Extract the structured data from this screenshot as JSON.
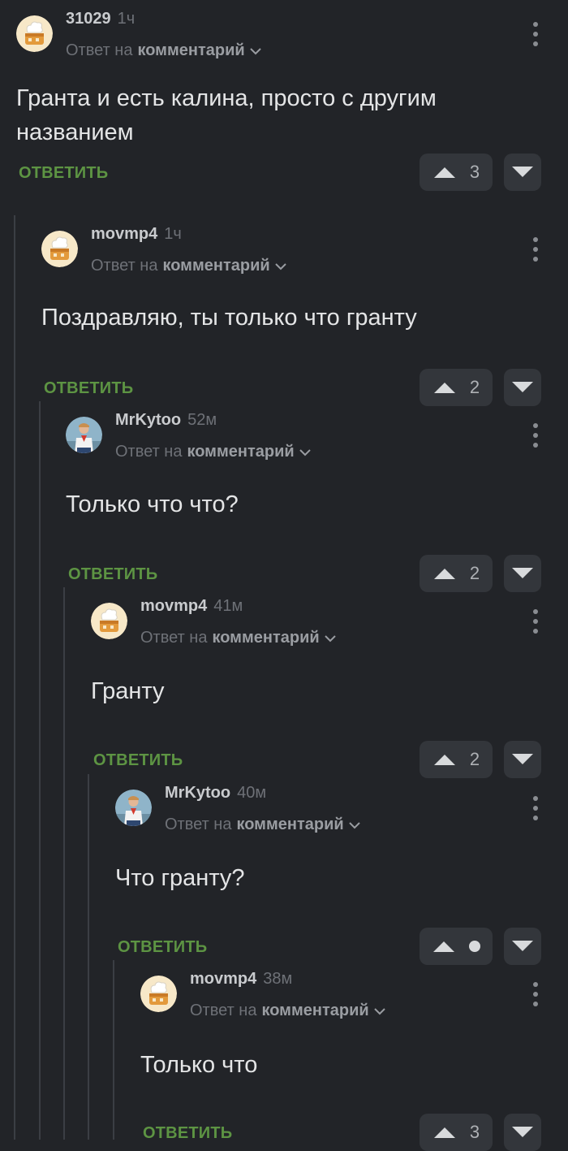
{
  "ui": {
    "reply_prefix": "Ответ на",
    "reply_target": "комментарий",
    "reply_button": "ОТВЕТИТЬ"
  },
  "comments": [
    {
      "author": "31029",
      "time": "1ч",
      "text": "Гранта и есть калина, просто с другим названием",
      "rating": "3",
      "avatar": "chef-hat-avatar"
    },
    {
      "author": "movmp4",
      "time": "1ч",
      "text": "Поздравляю, ты только что гранту",
      "rating": "2",
      "avatar": "chef-hat-avatar"
    },
    {
      "author": "MrKytoo",
      "time": "52м",
      "text": "Только что что?",
      "rating": "2",
      "avatar": "pioneer-photo-avatar"
    },
    {
      "author": "movmp4",
      "time": "41м",
      "text": "Гранту",
      "rating": "2",
      "avatar": "chef-hat-avatar"
    },
    {
      "author": "MrKytoo",
      "time": "40м",
      "text": "Что гранту?",
      "rating": "",
      "avatar": "pioneer-photo-avatar"
    },
    {
      "author": "movmp4",
      "time": "38м",
      "text": "Только что",
      "rating": "3",
      "avatar": "chef-hat-avatar"
    }
  ],
  "colors": {
    "background": "#222428",
    "reply_green": "#5d9443",
    "button_bg": "#33363b",
    "thread_line": "#3b3e44"
  }
}
